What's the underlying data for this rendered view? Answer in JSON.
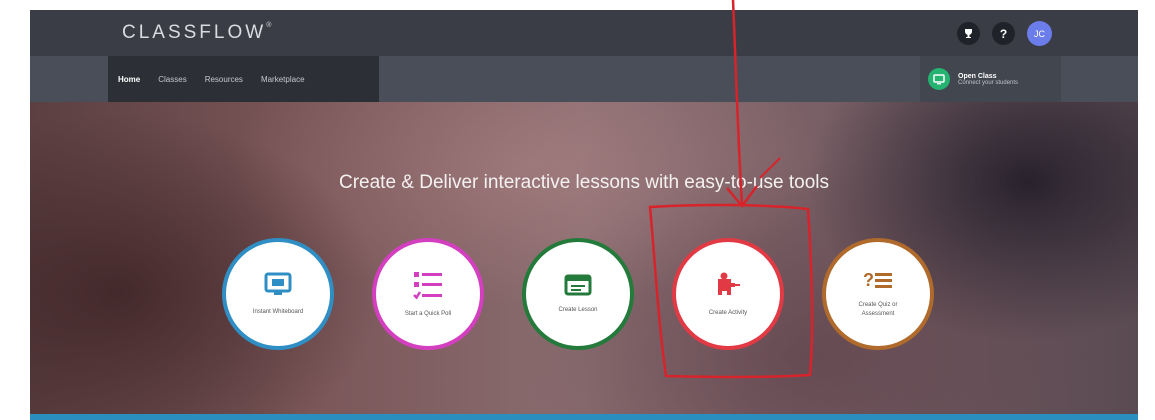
{
  "app": {
    "logo": "CLASSFLOW",
    "logo_mark": "®"
  },
  "header": {
    "trophy_icon": "trophy-icon",
    "help_glyph": "?",
    "avatar_initials": "JC"
  },
  "nav": {
    "tabs": [
      {
        "label": "Home",
        "active": true
      },
      {
        "label": "Classes"
      },
      {
        "label": "Resources"
      },
      {
        "label": "Marketplace"
      }
    ],
    "open_class": {
      "title": "Open Class",
      "subtitle": "Connect your students"
    }
  },
  "hero": {
    "title": "Create & Deliver interactive lessons with easy-to-use tools"
  },
  "tools": [
    {
      "label": "Instant Whiteboard",
      "icon": "whiteboard-icon",
      "color": "#2f8fc4"
    },
    {
      "label": "Start a Quick Poll",
      "icon": "poll-list-icon",
      "color": "#d43fbf"
    },
    {
      "label": "Create Lesson",
      "icon": "lesson-icon",
      "color": "#237a3b"
    },
    {
      "label": "Create Activity",
      "icon": "puzzle-icon",
      "color": "#e23a45"
    },
    {
      "label": "Create Quiz or Assessment",
      "icon": "quiz-icon",
      "color": "#b06a2c"
    }
  ],
  "colors": {
    "accent_blue": "#2a8fbf",
    "annotation_red": "#d8232a",
    "open_class_green": "#25b372"
  }
}
